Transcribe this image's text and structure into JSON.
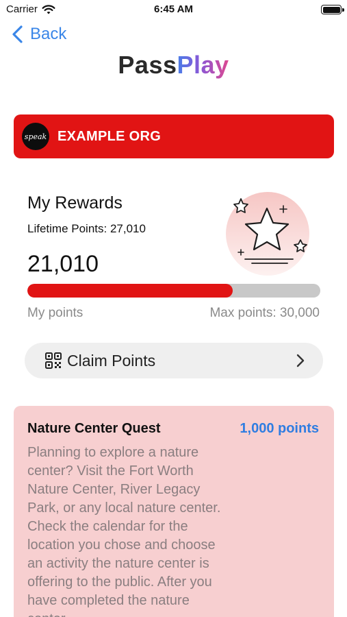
{
  "status_bar": {
    "carrier": "Carrier",
    "time": "6:45 AM"
  },
  "nav": {
    "back_label": "Back"
  },
  "logo": {
    "part1": "Pass",
    "part2": "Play"
  },
  "org": {
    "logo_text": "speak",
    "name": "EXAMPLE ORG",
    "color": "#e11414"
  },
  "rewards": {
    "title": "My Rewards",
    "lifetime_points": "Lifetime Points: 27,010",
    "current_points": "21,010",
    "my_points_label": "My points",
    "max_points_label": "Max points: 30,000",
    "progress_fraction": 0.7003
  },
  "claim": {
    "label": "Claim Points"
  },
  "quest": {
    "title": "Nature Center Quest",
    "points": "1,000 points",
    "description": "Planning to explore a nature center? Visit the Fort Worth Nature Center, River Legacy Park, or any local nature center. Check the calendar for the location you chose and choose an activity the nature center is offering to the public. After you have completed the nature center"
  },
  "colors": {
    "accent_blue": "#3a86e8",
    "brand_red": "#e11414",
    "card_pink": "#f7cfd0"
  }
}
